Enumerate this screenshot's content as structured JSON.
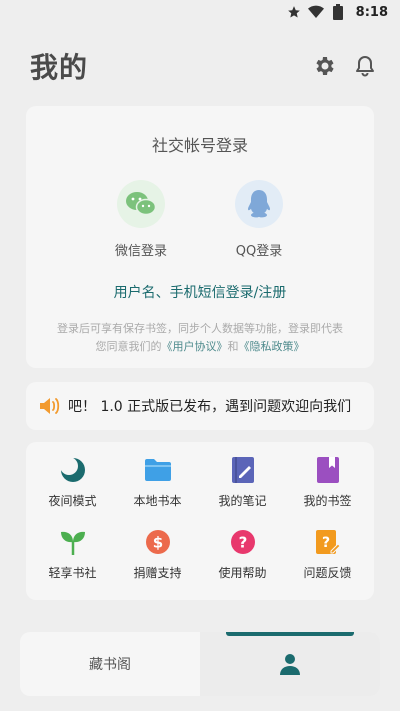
{
  "status_bar": {
    "time": "8:18",
    "icons": [
      "star-icon",
      "wifi-icon",
      "battery-icon"
    ]
  },
  "header": {
    "title": "我的",
    "actions": [
      "settings-icon",
      "bell-icon"
    ]
  },
  "login_card": {
    "title": "社交帐号登录",
    "wechat_label": "微信登录",
    "qq_label": "QQ登录",
    "account_login": "用户名、手机短信登录/注册",
    "note_line1": "登录后可享有保存书签，同步个人数据等功能，登录即代表",
    "note_prefix": "您同意我们的",
    "user_agreement": "《用户协议》",
    "note_and": "和",
    "privacy_policy": "《隐私政策》"
  },
  "notice": {
    "text": "吧！ 1.0 正式版已发布，遇到问题欢迎向我们"
  },
  "menu": {
    "items": [
      {
        "label": "夜间模式",
        "icon": "moon-icon"
      },
      {
        "label": "本地书本",
        "icon": "folder-icon"
      },
      {
        "label": "我的笔记",
        "icon": "notebook-icon"
      },
      {
        "label": "我的书签",
        "icon": "bookmark-icon"
      },
      {
        "label": "轻享书社",
        "icon": "sprout-icon"
      },
      {
        "label": "捐赠支持",
        "icon": "dollar-icon"
      },
      {
        "label": "使用帮助",
        "icon": "help-icon"
      },
      {
        "label": "问题反馈",
        "icon": "feedback-icon"
      }
    ]
  },
  "bottom_nav": {
    "tab_library": "藏书阁",
    "tab_mine_icon": "person-icon"
  },
  "colors": {
    "accent": "#1b6b6e",
    "background": "#eeeeee",
    "card": "#f6f6f6"
  }
}
